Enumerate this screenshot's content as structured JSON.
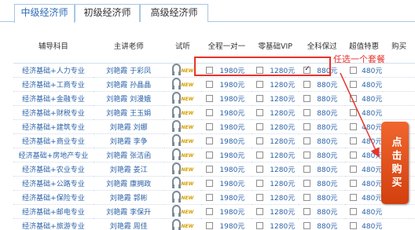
{
  "tabs": [
    {
      "label": "中级经济师",
      "active": true
    },
    {
      "label": "初级经济师",
      "active": false
    },
    {
      "label": "高级经济师",
      "active": false
    }
  ],
  "headers": {
    "subject": "辅导科目",
    "teacher": "主讲老师",
    "trial": "试听",
    "pkg1": "全程一对一",
    "pkg2": "零基础VIP",
    "pkg3": "全科保过",
    "pkg4": "超值特惠",
    "buy": "购买"
  },
  "new_badge": "NEW",
  "rows": [
    {
      "subject": "经济基础+人力专业",
      "teacher": "刘艳霞 于彩凤",
      "p1": "1980元",
      "p2": "1280元",
      "p3": "880元",
      "p4": "480元"
    },
    {
      "subject": "经济基础+工商专业",
      "teacher": "刘艳霞 孙晶晶",
      "p1": "1980元",
      "p2": "1280元",
      "p3": "880元",
      "p4": "480元"
    },
    {
      "subject": "经济基础+金融专业",
      "teacher": "刘艳霞 刘漫娥",
      "p1": "1980元",
      "p2": "1280元",
      "p3": "880元",
      "p4": "480元"
    },
    {
      "subject": "经济基础+财税专业",
      "teacher": "刘艳霞 王玉娟",
      "p1": "1980元",
      "p2": "1280元",
      "p3": "880元",
      "p4": "480元"
    },
    {
      "subject": "经济基础+建筑专业",
      "teacher": "刘艳霞 刘娜",
      "p1": "1980元",
      "p2": "1280元",
      "p3": "880元",
      "p4": "480元"
    },
    {
      "subject": "经济基础+商业专业",
      "teacher": "刘艳霞 李争",
      "p1": "1980元",
      "p2": "1280元",
      "p3": "880元",
      "p4": "480元"
    },
    {
      "subject": "经济基础+房地产专业",
      "teacher": "刘艳霞 张洁函",
      "p1": "1980元",
      "p2": "1280元",
      "p3": "880元",
      "p4": "480元"
    },
    {
      "subject": "经济基础+农业专业",
      "teacher": "刘艳霞 姜江",
      "p1": "1980元",
      "p2": "1280元",
      "p3": "880元",
      "p4": "480元"
    },
    {
      "subject": "经济基础+公路专业",
      "teacher": "刘艳霞 康拥政",
      "p1": "1980元",
      "p2": "1280元",
      "p3": "880元",
      "p4": "480元"
    },
    {
      "subject": "经济基础+保险专业",
      "teacher": "刘艳霞 郭彬",
      "p1": "1980元",
      "p2": "1280元",
      "p3": "880元",
      "p4": "480元"
    },
    {
      "subject": "经济基础+邮电专业",
      "teacher": "刘艳霞 李保升",
      "p1": "1980元",
      "p2": "1280元",
      "p3": "880元",
      "p4": "480元"
    },
    {
      "subject": "经济基础+旅游专业",
      "teacher": "刘艳霞 周佳",
      "p1": "1980元",
      "p2": "1280元",
      "p3": "880元",
      "p4": "480元"
    }
  ],
  "selected": {
    "row": 0,
    "package": "pkg3"
  },
  "callout": "任选一个套餐",
  "buy_button": "点击购买",
  "colors": {
    "accent_red": "#e8322c",
    "link_blue": "#2b62a8",
    "button_orange": "#e0521a"
  }
}
